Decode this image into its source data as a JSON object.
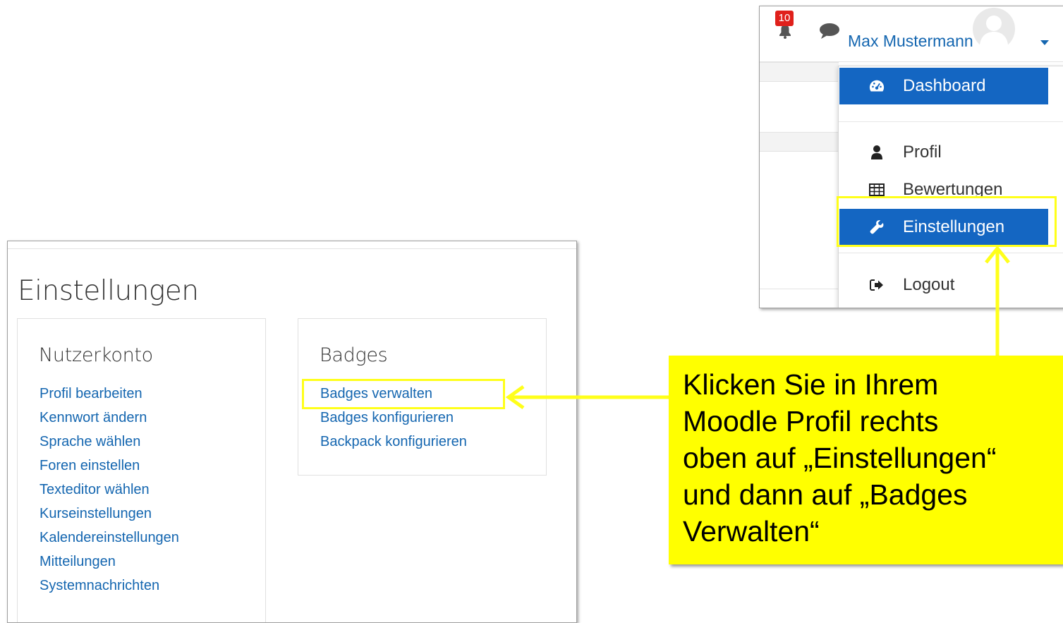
{
  "settings_page": {
    "title": "Einstellungen",
    "account_card": {
      "title": "Nutzerkonto",
      "links": [
        "Profil bearbeiten",
        "Kennwort ändern",
        "Sprache wählen",
        "Foren einstellen",
        "Texteditor wählen",
        "Kurseinstellungen",
        "Kalendereinstellungen",
        "Mitteilungen",
        "Systemnachrichten"
      ]
    },
    "badges_card": {
      "title": "Badges",
      "links": [
        "Badges verwalten",
        "Badges konfigurieren",
        "Backpack konfigurieren"
      ]
    }
  },
  "navbar": {
    "notification_count": "10",
    "user_name": "Max Mustermann",
    "icons": {
      "notifications": "bell-icon",
      "messages": "chat-bubble-icon",
      "avatar": "user-avatar-icon",
      "menu": "caret-down-icon"
    }
  },
  "user_menu": {
    "items": [
      {
        "label": "Dashboard",
        "icon": "tachometer-icon",
        "active": true
      },
      {
        "label": "Profil",
        "icon": "user-icon",
        "active": false
      },
      {
        "label": "Bewertungen",
        "icon": "table-icon",
        "active": false
      },
      {
        "label": "Einstellungen",
        "icon": "wrench-icon",
        "active": true
      },
      {
        "label": "Logout",
        "icon": "sign-out-icon",
        "active": false
      }
    ]
  },
  "callout": {
    "text": "Klicken Sie in Ihrem\nMoodle Profil rechts\noben auf „Einstellungen“\nund dann auf „Badges\nVerwalten“"
  },
  "colors": {
    "link": "#1466b0",
    "menu_active": "#1466c2",
    "highlight": "#ffff00",
    "notification_badge": "#e0201b"
  }
}
